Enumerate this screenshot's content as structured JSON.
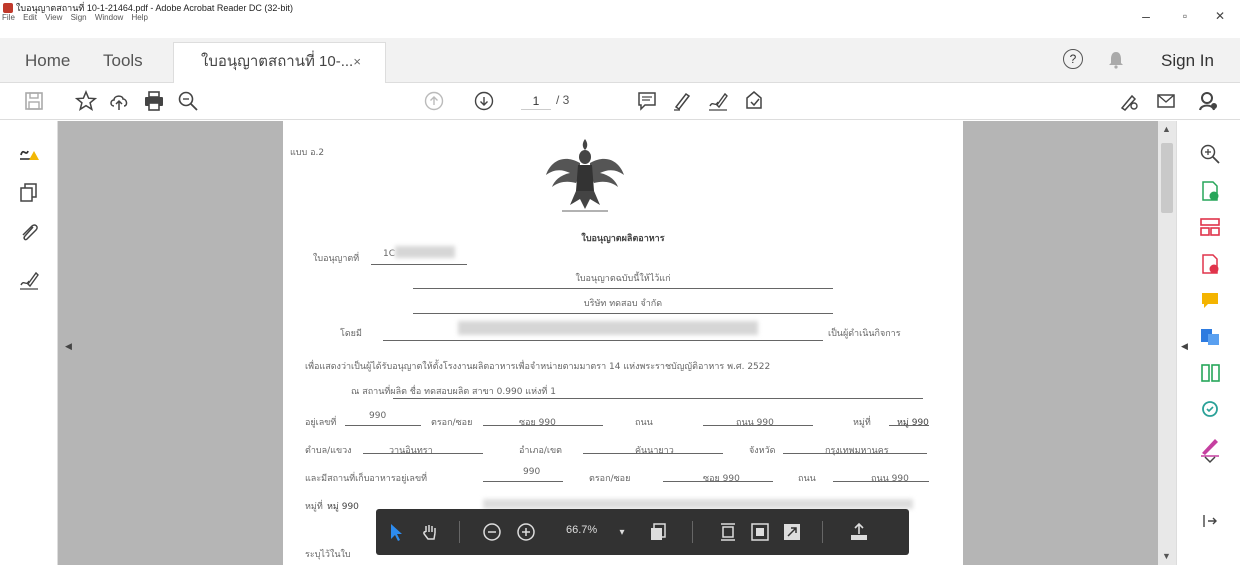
{
  "window": {
    "title": "ใบอนุญาตสถานที่ 10-1-21464.pdf - Adobe Acrobat Reader DC (32-bit)",
    "menu": [
      "File",
      "Edit",
      "View",
      "Sign",
      "Window",
      "Help"
    ],
    "controls": {
      "minimize": "–",
      "maximize": "▫",
      "close": "✕"
    }
  },
  "tabs": {
    "home": "Home",
    "tools": "Tools",
    "document": "ใบอนุญาตสถานที่ 10-...",
    "document_close": "×"
  },
  "header_right": {
    "sign_in": "Sign In"
  },
  "toolbar": {
    "page_current": "1",
    "page_total": "/ 3"
  },
  "document": {
    "form_code": "แบบ อ.2",
    "heading": "ใบอนุญาตผลิตอาหาร",
    "license_no_label": "ใบอนุญาตที่",
    "license_no_value": "1C",
    "grant_line": "ใบอนุญาตฉบับนี้ให้ไว้แก่",
    "company": "บริษัท ทดสอบ จำกัด",
    "by_label": "โดยมี",
    "operator_label": "เป็นผู้ดำเนินกิจการ",
    "purpose_line": "เพื่อแสดงว่าเป็นผู้ได้รับอนุญาตให้ตั้งโรงงานผลิตอาหารเพื่อจำหน่ายตามมาตรา 14 แห่งพระราชบัญญัติอาหาร พ.ศ. 2522",
    "location_line": "ณ สถานที่ผลิต ชื่อ ทดสอบผลิต สาขา 0.990 แห่งที่ 1",
    "row1": {
      "house_label": "อยู่เลขที่",
      "house": "990",
      "trok_label": "ตรอก/ซอย",
      "soi": "ซอย 990",
      "road_label": "ถนน",
      "road": "ถนน 990",
      "moo_label": "หมู่ที่",
      "moo": "หมู่ 990"
    },
    "row2": {
      "tambon_label": "ตำบล/แขวง",
      "tambon": "วานอินทรา",
      "amphoe_label": "อำเภอ/เขต",
      "amphoe": "คันนายาว",
      "province_label": "จังหวัด",
      "province": "กรุงเทพมหานคร"
    },
    "row3": {
      "store_label": "และมีสถานที่เก็บอาหารอยู่เลขที่",
      "house": "990",
      "trok_label": "ตรอก/ซอย",
      "soi": "ซอย 990",
      "road_label": "ถนน",
      "road": "ถนน 990"
    },
    "row4": {
      "moo_label": "หมู่ที่",
      "moo": "หมู่ 990"
    },
    "row5": "ระบุไว้ในใบ"
  },
  "floating_toolbar": {
    "zoom": "66.7%"
  }
}
